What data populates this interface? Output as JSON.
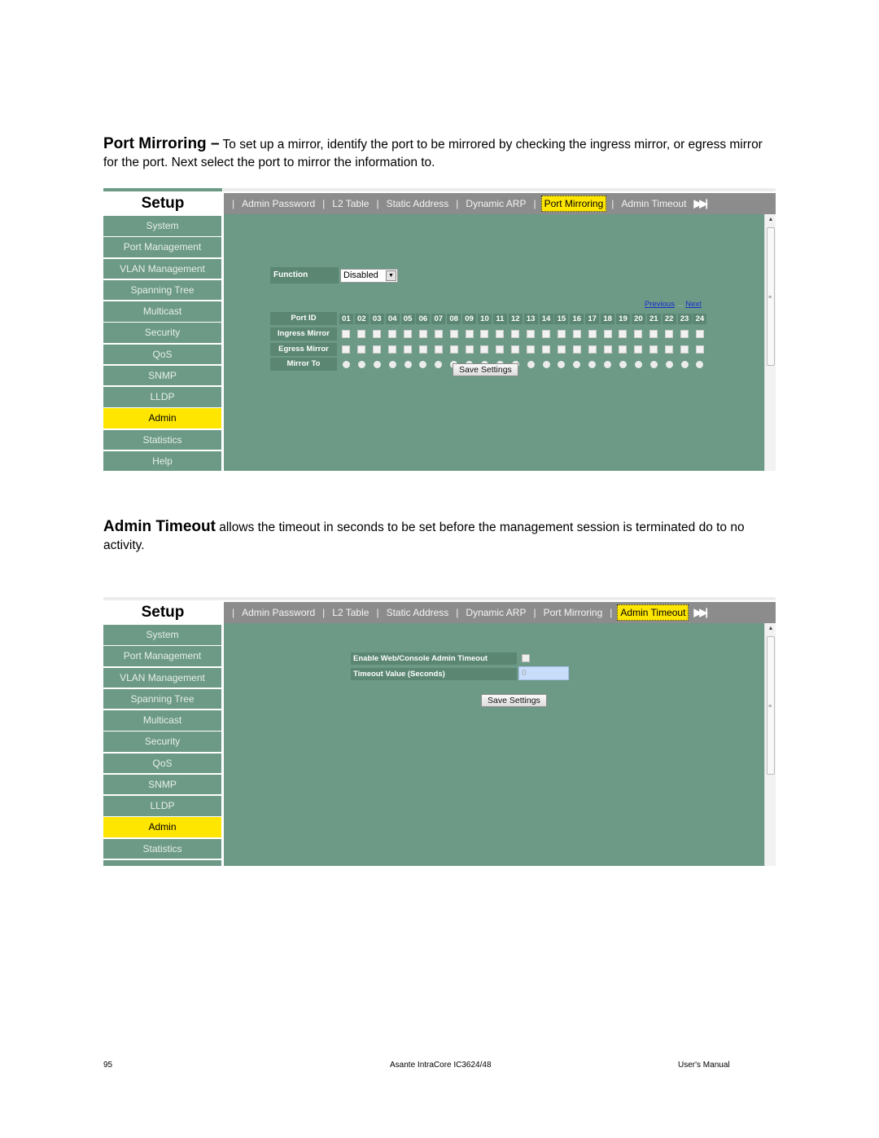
{
  "section1": {
    "heading": "Port Mirroring –",
    "body": " To set up a mirror, identify the port to be mirrored by checking the ingress mirror, or egress mirror for the port.  Next select the port to mirror the information to."
  },
  "section2": {
    "heading": "Admin Timeout",
    "body": " allows the timeout in seconds to be set before the management session is terminated do to no activity."
  },
  "ui": {
    "setup_title": "Setup",
    "tabs": [
      "Admin Password",
      "L2 Table",
      "Static Address",
      "Dynamic ARP",
      "Port Mirroring",
      "Admin Timeout"
    ],
    "tab_more_glyph": "▶▶|",
    "tab_separator": "|",
    "sidebar": [
      "System",
      "Port Management",
      "VLAN Management",
      "Spanning Tree",
      "Multicast",
      "Security",
      "QoS",
      "SNMP",
      "LLDP",
      "Admin",
      "Statistics",
      "Help"
    ],
    "sidebar_active": "Admin",
    "accent_color": "#ffe600",
    "panel_color": "#6c9a86"
  },
  "screenshot1": {
    "active_tab": "Port Mirroring",
    "function_label": "Function",
    "function_value": "Disabled",
    "pager_previous": "Previous",
    "pager_dots": "...",
    "pager_next": "Next",
    "row_labels": {
      "port_id": "Port ID",
      "ingress": "Ingress Mirror",
      "egress": "Egress Mirror",
      "mirror_to": "Mirror To"
    },
    "ports": [
      "01",
      "02",
      "03",
      "04",
      "05",
      "06",
      "07",
      "08",
      "09",
      "10",
      "11",
      "12",
      "13",
      "14",
      "15",
      "16",
      "17",
      "18",
      "19",
      "20",
      "21",
      "22",
      "23",
      "24"
    ],
    "save_label": "Save Settings"
  },
  "screenshot2": {
    "active_tab": "Admin Timeout",
    "enable_label": "Enable Web/Console Admin Timeout",
    "timeout_label": "Timeout Value (Seconds)",
    "timeout_value": "0",
    "enable_checked": false,
    "save_label": "Save Settings"
  },
  "footer": {
    "page_number": "95",
    "product": "Asante IntraCore IC3624/48",
    "manual": "User's Manual"
  }
}
